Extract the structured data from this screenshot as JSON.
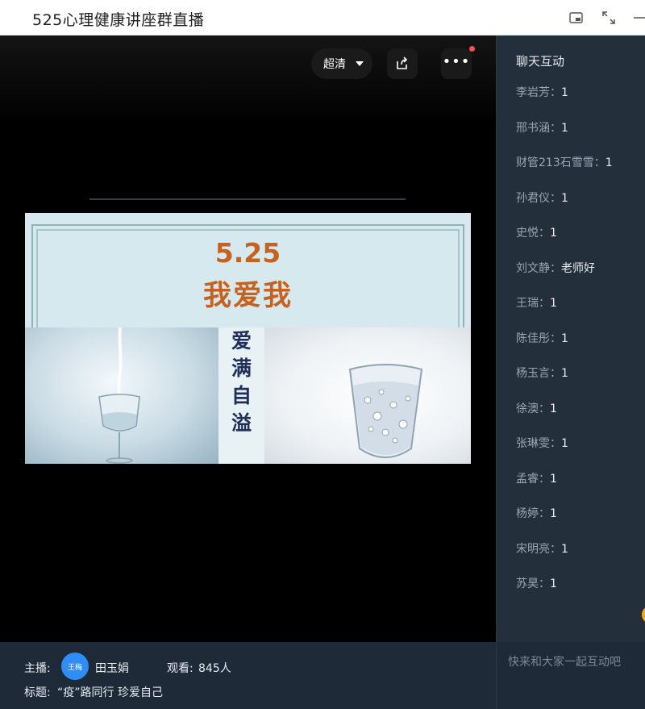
{
  "window": {
    "title": "525心理健康讲座群直播",
    "icons": [
      "pip-icon",
      "fullscreen-icon",
      "minimize-icon"
    ]
  },
  "player": {
    "quality_label": "超清",
    "share_icon": "share-icon",
    "more_icon": "more-icon",
    "notification_dot_color": "#ff4d4f"
  },
  "slide": {
    "number": "5.25",
    "title": "我爱我",
    "vertical_text": [
      "爱",
      "满",
      "自",
      "溢"
    ],
    "colors": {
      "title": "#c7611d",
      "vertical_text": "#1f2e5a",
      "background": "#d5e9ee"
    }
  },
  "info": {
    "host_label": "主播:",
    "avatar_text": "王梅",
    "host_name": "田玉娟",
    "viewers_label": "观看:",
    "viewers_count": "845人",
    "topic_label": "标题:",
    "topic": "“疫”路同行 珍爱自己"
  },
  "chat": {
    "title": "聊天互动",
    "messages": [
      {
        "user": "李岩芳",
        "text": "1"
      },
      {
        "user": "邢书涵",
        "text": "1"
      },
      {
        "user": "财管213石雪雪",
        "text": "1"
      },
      {
        "user": "孙君仪",
        "text": "1"
      },
      {
        "user": "史悦",
        "text": "1"
      },
      {
        "user": "刘文静",
        "text": "老师好"
      },
      {
        "user": "王瑞",
        "text": "1"
      },
      {
        "user": "陈佳彤",
        "text": "1"
      },
      {
        "user": "杨玉言",
        "text": "1"
      },
      {
        "user": "徐澳",
        "text": "1"
      },
      {
        "user": "张琳雯",
        "text": "1"
      },
      {
        "user": "孟睿",
        "text": "1"
      },
      {
        "user": "杨婷",
        "text": "1"
      },
      {
        "user": "宋明亮",
        "text": "1"
      },
      {
        "user": "苏昊",
        "text": "1"
      }
    ],
    "input_placeholder": "快来和大家一起互动吧"
  }
}
